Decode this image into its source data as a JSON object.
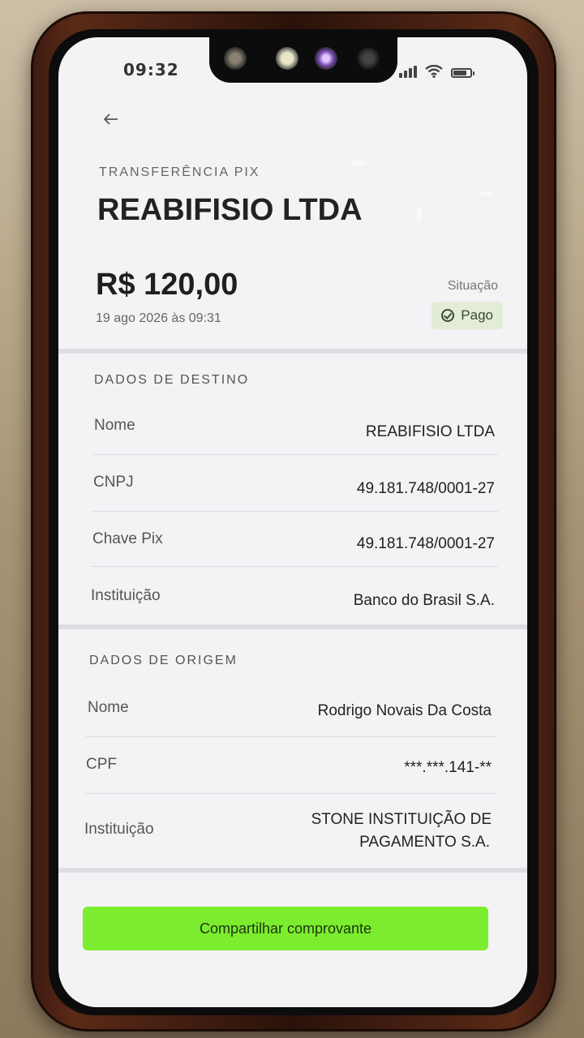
{
  "statusbar": {
    "time": "09:32"
  },
  "header": {
    "back_icon": "arrow-left-icon",
    "kicker": "TRANSFERÊNCIA PIX",
    "title": "REABIFISIO LTDA"
  },
  "summary": {
    "amount": "R$ 120,00",
    "datetime": "19 ago 2026 às 09:31",
    "status_label": "Situação",
    "status_value": "Pago",
    "status_icon": "check-circle-icon",
    "status_color": "#e3ecd8"
  },
  "destino": {
    "title": "DADOS DE DESTINO",
    "rows": [
      {
        "label": "Nome",
        "value": "REABIFISIO LTDA"
      },
      {
        "label": "CNPJ",
        "value": "49.181.748/0001-27"
      },
      {
        "label": "Chave Pix",
        "value": "49.181.748/0001-27"
      },
      {
        "label": "Instituição",
        "value": "Banco do Brasil S.A."
      }
    ]
  },
  "origem": {
    "title": "DADOS DE ORIGEM",
    "rows": [
      {
        "label": "Nome",
        "value": "Rodrigo Novais Da Costa"
      },
      {
        "label": "CPF",
        "value": "***.***.141-**"
      },
      {
        "label": "Instituição",
        "value_line1": "STONE INSTITUIÇÃO DE",
        "value_line2": "PAGAMENTO S.A."
      }
    ]
  },
  "actions": {
    "share_label": "Compartilhar comprovante",
    "share_color": "#7ced2e"
  }
}
